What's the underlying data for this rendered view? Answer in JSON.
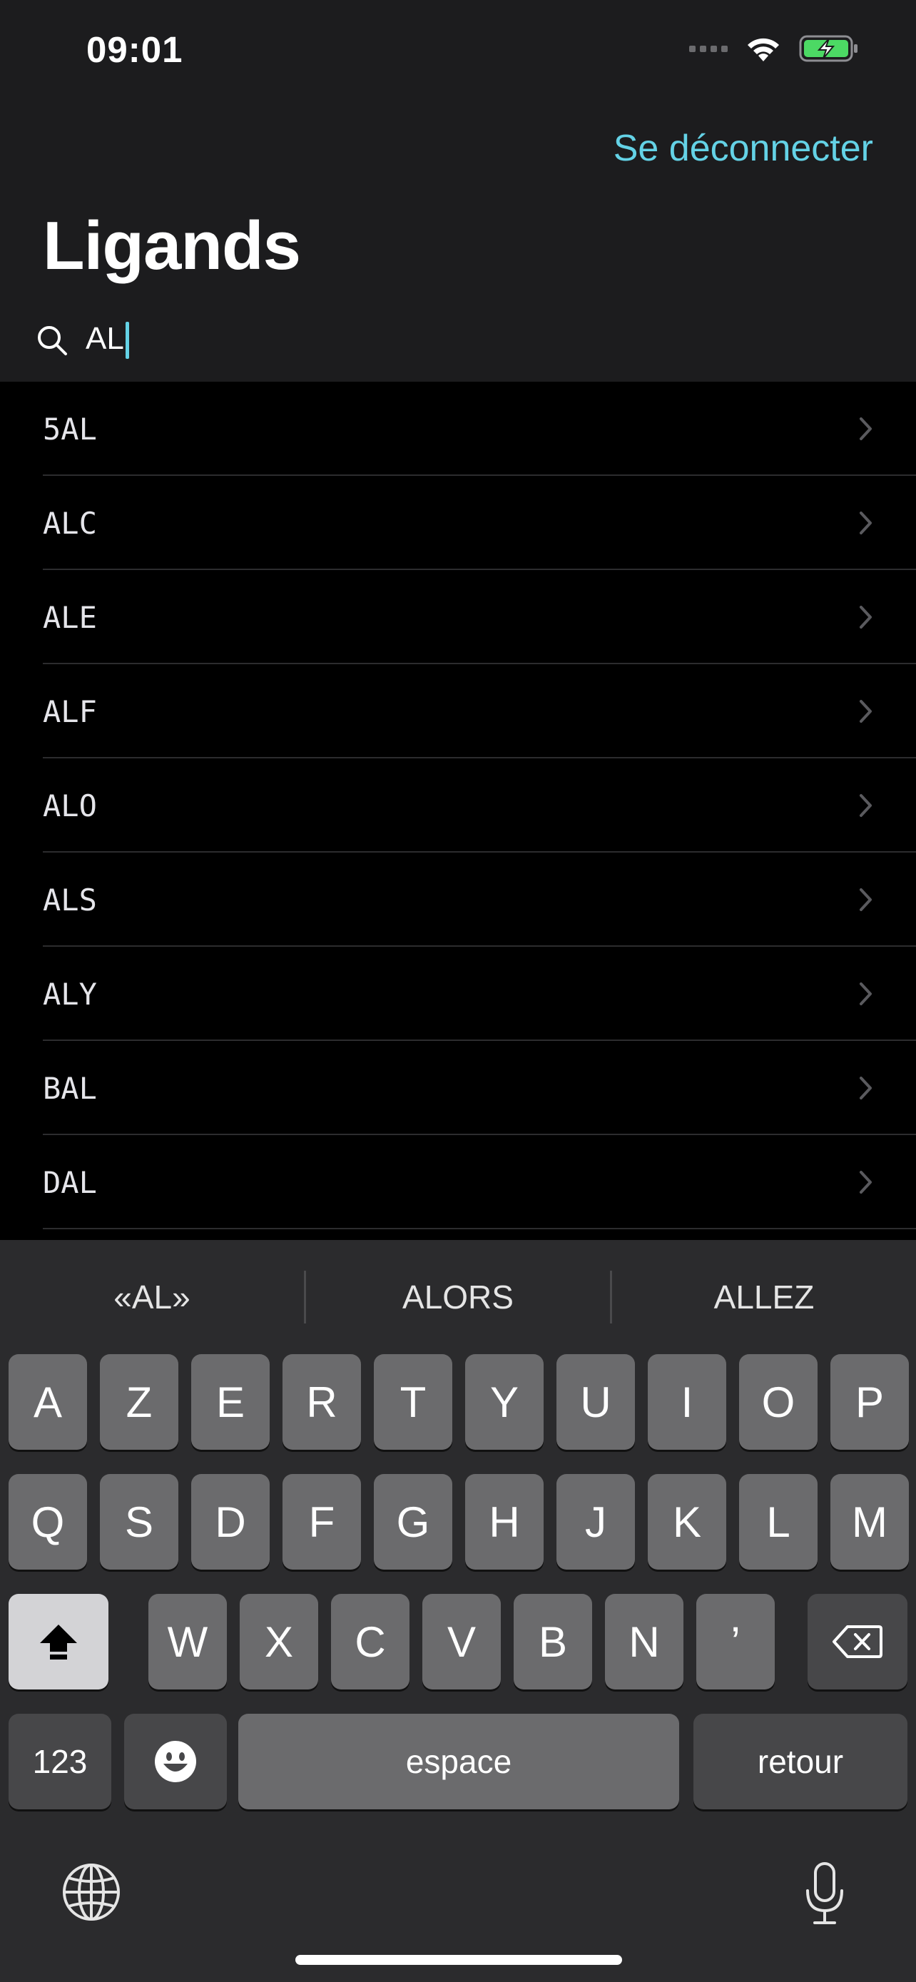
{
  "status_bar": {
    "time": "09:01"
  },
  "nav": {
    "logout_label": "Se déconnecter",
    "title": "Ligands"
  },
  "search": {
    "value": "AL"
  },
  "results": [
    {
      "label": "5AL"
    },
    {
      "label": "ALC"
    },
    {
      "label": "ALE"
    },
    {
      "label": "ALF"
    },
    {
      "label": "ALO"
    },
    {
      "label": "ALS"
    },
    {
      "label": "ALY"
    },
    {
      "label": "BAL"
    },
    {
      "label": "DAL"
    }
  ],
  "keyboard": {
    "suggestions": [
      "«AL»",
      "ALORS",
      "ALLEZ"
    ],
    "row1": [
      "A",
      "Z",
      "E",
      "R",
      "T",
      "Y",
      "U",
      "I",
      "O",
      "P"
    ],
    "row2": [
      "Q",
      "S",
      "D",
      "F",
      "G",
      "H",
      "J",
      "K",
      "L",
      "M"
    ],
    "row3": [
      "W",
      "X",
      "C",
      "V",
      "B",
      "N",
      "’"
    ],
    "numbers_label": "123",
    "space_label": "espace",
    "return_label": "retour"
  },
  "colors": {
    "accent": "#64d2e6",
    "nav_background": "#1c1c1e",
    "list_background": "#000000",
    "keyboard_background": "#2b2b2d"
  }
}
